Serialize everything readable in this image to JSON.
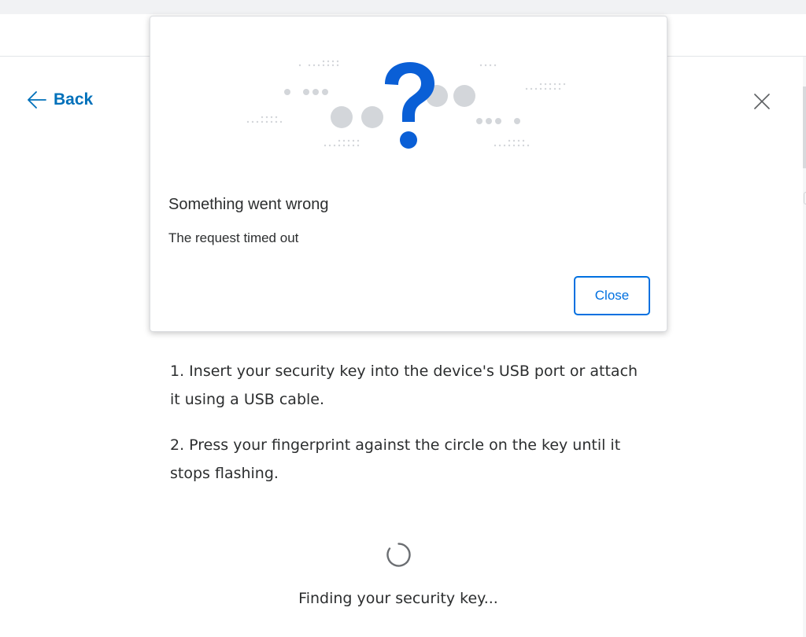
{
  "header": {
    "back_label": "Back"
  },
  "dialog": {
    "title": "Something went wrong",
    "message": "The request timed out",
    "close_label": "Close"
  },
  "instructions": {
    "steps": [
      "1. Insert your security key into the device's USB port or attach it using a USB cable.",
      "2. Press your fingerprint against the circle on the key until it stops flashing."
    ]
  },
  "status": {
    "text": "Finding your security key..."
  },
  "icons": {
    "back": "arrow-left-icon",
    "close": "close-icon",
    "illustration": "question-mark-icon",
    "spinner": "loading-spinner-icon"
  },
  "colors": {
    "link": "#0070ba",
    "button": "#0070e0",
    "question_mark": "#0a5fd6",
    "dots": "#d6d8dc",
    "text": "#2c2e2f"
  }
}
